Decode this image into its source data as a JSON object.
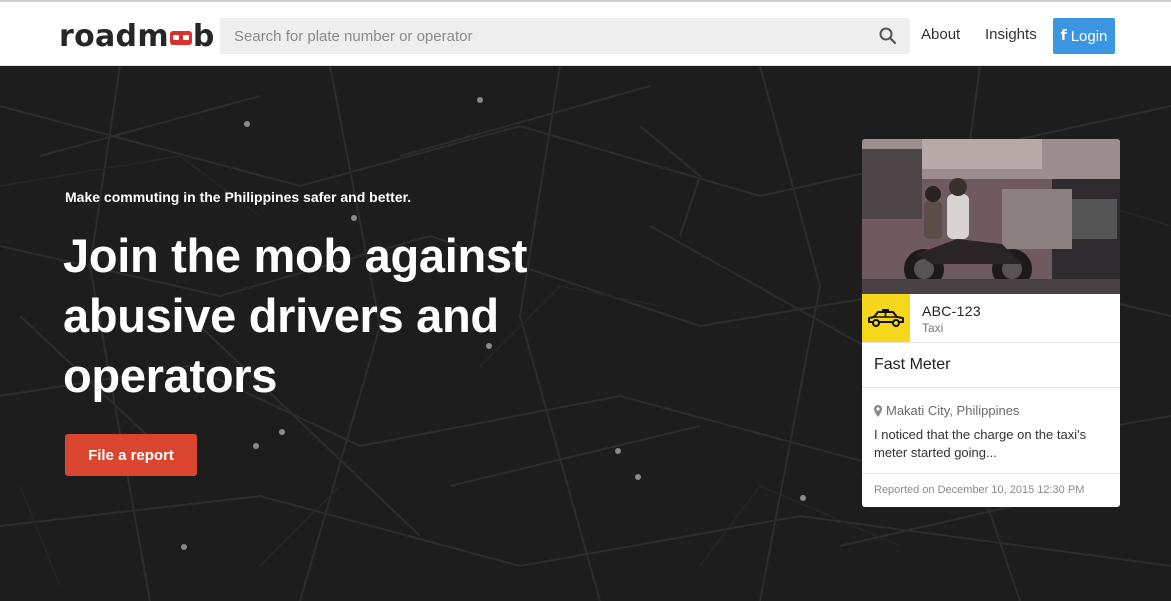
{
  "header": {
    "logo_left": "roadm",
    "logo_right": "b",
    "search_placeholder": "Search for plate number or operator",
    "nav": {
      "about": "About",
      "insights": "Insights",
      "login_icon": "f",
      "login": "Login"
    }
  },
  "hero": {
    "tagline": "Make commuting in the Philippines safer and better.",
    "headline": "Join the mob against abusive drivers and operators",
    "cta": "File a report"
  },
  "card": {
    "plate": "ABC-123",
    "vehicle_type": "Taxi",
    "title": "Fast Meter",
    "location": "Makati City, Philippines",
    "description": "I noticed that the charge on the taxi's meter started going...",
    "reported": "Reported on December 10, 2015 12:30 PM"
  },
  "icons": {
    "search": "search-icon",
    "taxi": "taxi-icon",
    "location": "map-marker-icon",
    "facebook": "facebook-icon"
  },
  "colors": {
    "brand_red": "#d9322c",
    "cta_red": "#d9452f",
    "login_blue": "#3b95e0",
    "taxi_yellow": "#f7d71c",
    "hero_bg": "#1d1d1d"
  }
}
